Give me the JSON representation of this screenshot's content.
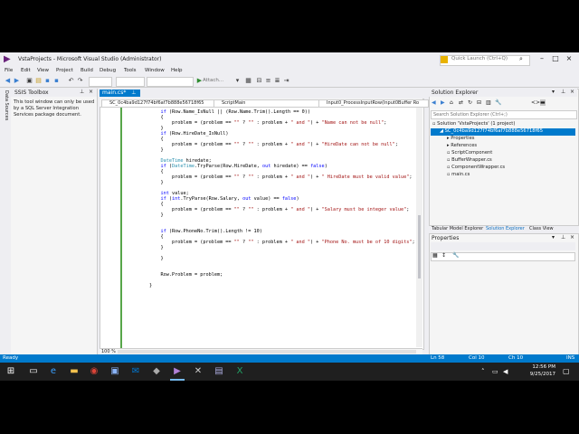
{
  "window": {
    "title": "VstaProjects - Microsoft Visual Studio (Administrator)",
    "quick_launch_placeholder": "Quick Launch (Ctrl+Q)"
  },
  "menu": [
    "File",
    "Edit",
    "View",
    "Project",
    "Build",
    "Debug",
    "Tools",
    "Window",
    "Help"
  ],
  "toolbar": {
    "attach_label": "Attach..."
  },
  "left_strip": {
    "tab": "Data Sources"
  },
  "ssis_toolbox": {
    "title": "SSIS Toolbox",
    "message": "This tool window can only be used by a SQL Server Integration Services package document."
  },
  "editor": {
    "tab": "main.cs*",
    "nav_class": "SC_0c4ba9d127f74bf6af7b888e56718f65",
    "nav_member_scope": "ScriptMain",
    "nav_method": "Input0_ProcessInputRow(Input0Buffer Ro",
    "zoom": "100 %"
  },
  "code_lines": [
    "            if (Row.Name_IsNull || (Row.Name.Trim().Length == 0))",
    "            {",
    "                problem = (problem == \"\" ? \"\" : problem + \" and \") + \"Name can not be null\";",
    "            }",
    "            if (Row.HireDate_IsNull)",
    "            {",
    "                problem = (problem == \"\" ? \"\" : problem + \" and \") + \"HireDate can not be null\";",
    "            }",
    "",
    "            DateTime hiredate;",
    "            if (DateTime.TryParse(Row.HireDate, out hiredate) == false)",
    "            {",
    "                problem = (problem == \"\" ? \"\" : problem + \" and \") + \" HireDate must be valid value\";",
    "            }",
    "",
    "            int value;",
    "            if (int.TryParse(Row.Salary, out value) == false)",
    "            {",
    "                problem = (problem == \"\" ? \"\" : problem + \" and \") + \"Salary must be integer value\";",
    "            }",
    "",
    "",
    "            if (Row.PhoneNo.Trim().Length != 10)",
    "            {",
    "                problem = (problem == \"\" ? \"\" : problem + \" and \") + \"Phone No. must be of 10 digits\";",
    "            }",
    "",
    "            }",
    "",
    "",
    "            Row.Problem = problem;",
    "",
    "        }"
  ],
  "solution_explorer": {
    "title": "Solution Explorer",
    "search_placeholder": "Search Solution Explorer (Ctrl+;)",
    "tree": [
      {
        "label": "Solution 'VstaProjects' (1 project)",
        "indent": 0,
        "selected": false
      },
      {
        "label": "SC_0c4ba9d127f74bf6af7b888e56718f65",
        "indent": 1,
        "selected": true
      },
      {
        "label": "Properties",
        "indent": 2,
        "selected": false
      },
      {
        "label": "References",
        "indent": 2,
        "selected": false
      },
      {
        "label": "ScriptComponent",
        "indent": 2,
        "selected": false
      },
      {
        "label": "BufferWrapper.cs",
        "indent": 2,
        "selected": false
      },
      {
        "label": "ComponentWrapper.cs",
        "indent": 2,
        "selected": false
      },
      {
        "label": "main.cs",
        "indent": 2,
        "selected": false
      }
    ],
    "tabs": [
      "Tabular Model Explorer",
      "Solution Explorer",
      "Class View"
    ]
  },
  "properties": {
    "title": "Properties"
  },
  "status": {
    "ready": "Ready",
    "line": "Ln 58",
    "col": "Col 10",
    "ch": "Ch 10",
    "mode": "INS"
  },
  "taskbar": {
    "time": "12:56 PM",
    "date": "9/25/2017"
  }
}
